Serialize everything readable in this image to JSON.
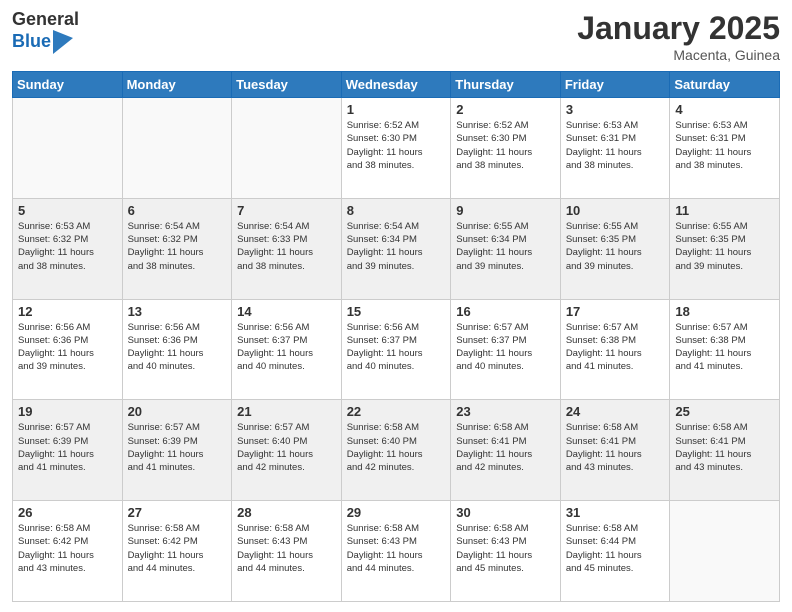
{
  "header": {
    "logo_general": "General",
    "logo_blue": "Blue",
    "month_title": "January 2025",
    "subtitle": "Macenta, Guinea"
  },
  "weekdays": [
    "Sunday",
    "Monday",
    "Tuesday",
    "Wednesday",
    "Thursday",
    "Friday",
    "Saturday"
  ],
  "weeks": [
    [
      {
        "day": "",
        "info": ""
      },
      {
        "day": "",
        "info": ""
      },
      {
        "day": "",
        "info": ""
      },
      {
        "day": "1",
        "info": "Sunrise: 6:52 AM\nSunset: 6:30 PM\nDaylight: 11 hours\nand 38 minutes."
      },
      {
        "day": "2",
        "info": "Sunrise: 6:52 AM\nSunset: 6:30 PM\nDaylight: 11 hours\nand 38 minutes."
      },
      {
        "day": "3",
        "info": "Sunrise: 6:53 AM\nSunset: 6:31 PM\nDaylight: 11 hours\nand 38 minutes."
      },
      {
        "day": "4",
        "info": "Sunrise: 6:53 AM\nSunset: 6:31 PM\nDaylight: 11 hours\nand 38 minutes."
      }
    ],
    [
      {
        "day": "5",
        "info": "Sunrise: 6:53 AM\nSunset: 6:32 PM\nDaylight: 11 hours\nand 38 minutes."
      },
      {
        "day": "6",
        "info": "Sunrise: 6:54 AM\nSunset: 6:32 PM\nDaylight: 11 hours\nand 38 minutes."
      },
      {
        "day": "7",
        "info": "Sunrise: 6:54 AM\nSunset: 6:33 PM\nDaylight: 11 hours\nand 38 minutes."
      },
      {
        "day": "8",
        "info": "Sunrise: 6:54 AM\nSunset: 6:34 PM\nDaylight: 11 hours\nand 39 minutes."
      },
      {
        "day": "9",
        "info": "Sunrise: 6:55 AM\nSunset: 6:34 PM\nDaylight: 11 hours\nand 39 minutes."
      },
      {
        "day": "10",
        "info": "Sunrise: 6:55 AM\nSunset: 6:35 PM\nDaylight: 11 hours\nand 39 minutes."
      },
      {
        "day": "11",
        "info": "Sunrise: 6:55 AM\nSunset: 6:35 PM\nDaylight: 11 hours\nand 39 minutes."
      }
    ],
    [
      {
        "day": "12",
        "info": "Sunrise: 6:56 AM\nSunset: 6:36 PM\nDaylight: 11 hours\nand 39 minutes."
      },
      {
        "day": "13",
        "info": "Sunrise: 6:56 AM\nSunset: 6:36 PM\nDaylight: 11 hours\nand 40 minutes."
      },
      {
        "day": "14",
        "info": "Sunrise: 6:56 AM\nSunset: 6:37 PM\nDaylight: 11 hours\nand 40 minutes."
      },
      {
        "day": "15",
        "info": "Sunrise: 6:56 AM\nSunset: 6:37 PM\nDaylight: 11 hours\nand 40 minutes."
      },
      {
        "day": "16",
        "info": "Sunrise: 6:57 AM\nSunset: 6:37 PM\nDaylight: 11 hours\nand 40 minutes."
      },
      {
        "day": "17",
        "info": "Sunrise: 6:57 AM\nSunset: 6:38 PM\nDaylight: 11 hours\nand 41 minutes."
      },
      {
        "day": "18",
        "info": "Sunrise: 6:57 AM\nSunset: 6:38 PM\nDaylight: 11 hours\nand 41 minutes."
      }
    ],
    [
      {
        "day": "19",
        "info": "Sunrise: 6:57 AM\nSunset: 6:39 PM\nDaylight: 11 hours\nand 41 minutes."
      },
      {
        "day": "20",
        "info": "Sunrise: 6:57 AM\nSunset: 6:39 PM\nDaylight: 11 hours\nand 41 minutes."
      },
      {
        "day": "21",
        "info": "Sunrise: 6:57 AM\nSunset: 6:40 PM\nDaylight: 11 hours\nand 42 minutes."
      },
      {
        "day": "22",
        "info": "Sunrise: 6:58 AM\nSunset: 6:40 PM\nDaylight: 11 hours\nand 42 minutes."
      },
      {
        "day": "23",
        "info": "Sunrise: 6:58 AM\nSunset: 6:41 PM\nDaylight: 11 hours\nand 42 minutes."
      },
      {
        "day": "24",
        "info": "Sunrise: 6:58 AM\nSunset: 6:41 PM\nDaylight: 11 hours\nand 43 minutes."
      },
      {
        "day": "25",
        "info": "Sunrise: 6:58 AM\nSunset: 6:41 PM\nDaylight: 11 hours\nand 43 minutes."
      }
    ],
    [
      {
        "day": "26",
        "info": "Sunrise: 6:58 AM\nSunset: 6:42 PM\nDaylight: 11 hours\nand 43 minutes."
      },
      {
        "day": "27",
        "info": "Sunrise: 6:58 AM\nSunset: 6:42 PM\nDaylight: 11 hours\nand 44 minutes."
      },
      {
        "day": "28",
        "info": "Sunrise: 6:58 AM\nSunset: 6:43 PM\nDaylight: 11 hours\nand 44 minutes."
      },
      {
        "day": "29",
        "info": "Sunrise: 6:58 AM\nSunset: 6:43 PM\nDaylight: 11 hours\nand 44 minutes."
      },
      {
        "day": "30",
        "info": "Sunrise: 6:58 AM\nSunset: 6:43 PM\nDaylight: 11 hours\nand 45 minutes."
      },
      {
        "day": "31",
        "info": "Sunrise: 6:58 AM\nSunset: 6:44 PM\nDaylight: 11 hours\nand 45 minutes."
      },
      {
        "day": "",
        "info": ""
      }
    ]
  ]
}
